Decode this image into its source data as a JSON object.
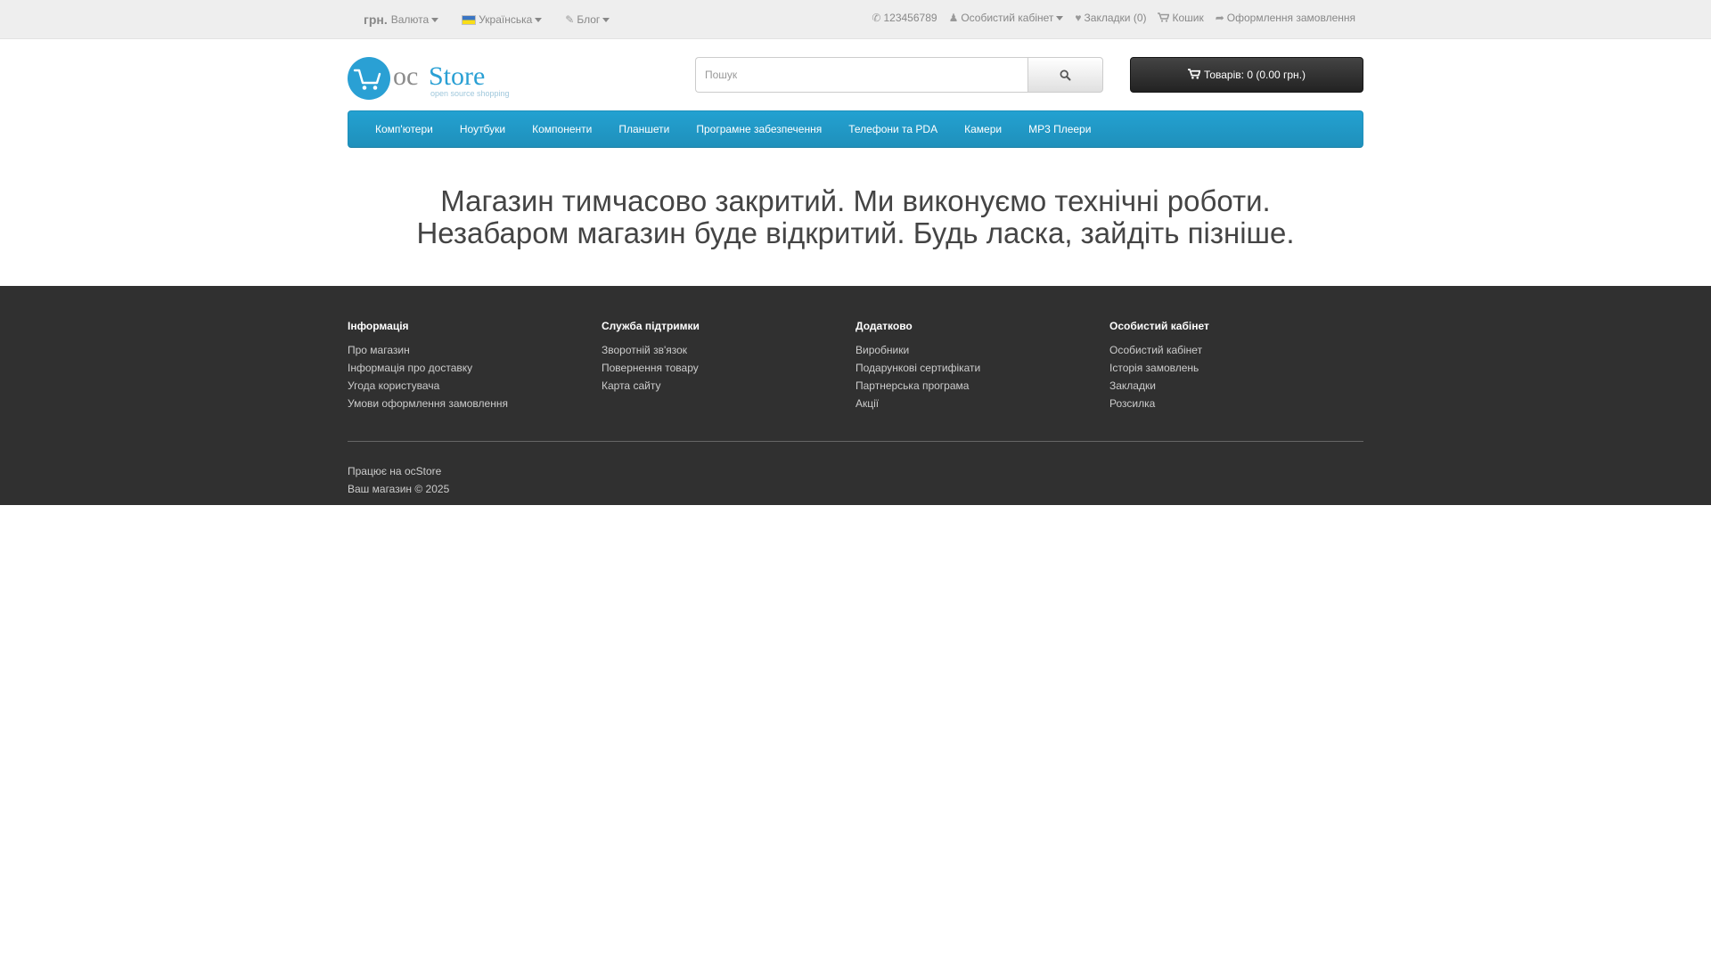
{
  "top": {
    "currency_symbol": "грн.",
    "currency_label": "Валюта",
    "language_label": "Українська",
    "blog_label": "Блог",
    "phone": "123456789",
    "account_label": "Особистий кабінет",
    "wishlist_label": "Закладки (0)",
    "cart_label": "Кошик",
    "checkout_label": "Оформлення замовлення"
  },
  "header": {
    "logo_text_oc": "oc",
    "logo_text_store": "Store",
    "logo_tagline": "open source shopping",
    "search_placeholder": "Пошук",
    "cart_button": "Товарів: 0 (0.00 грн.)"
  },
  "menu": {
    "items": [
      {
        "label": "Комп'ютери"
      },
      {
        "label": "Ноутбуки"
      },
      {
        "label": "Компоненти"
      },
      {
        "label": "Планшети"
      },
      {
        "label": "Програмне забезпечення"
      },
      {
        "label": "Телефони та PDA"
      },
      {
        "label": "Камери"
      },
      {
        "label": "MP3 Плеери"
      }
    ]
  },
  "content": {
    "line1": "Магазин тимчасово закритий. Ми виконуємо технічні роботи.",
    "line2": "Незабаром магазин буде відкритий. Будь ласка, зайдіть пізніше."
  },
  "footer": {
    "columns": [
      {
        "title": "Інформація",
        "links": [
          "Про магазин",
          "Інформація про доставку",
          "Угода користувача",
          "Умови оформлення замовлення"
        ]
      },
      {
        "title": "Служба підтримки",
        "links": [
          "Зворотній зв'язок",
          "Повернення товару",
          "Карта сайту"
        ]
      },
      {
        "title": "Додатково",
        "links": [
          "Виробники",
          "Подарункові сертифікати",
          "Партнерська програма",
          "Акції"
        ]
      },
      {
        "title": "Особистий кабінет",
        "links": [
          "Особистий кабінет",
          "Історія замовлень",
          "Закладки",
          "Розсилка"
        ]
      }
    ],
    "powered_prefix": "Працює на",
    "powered_brand": "ocStore",
    "copyright": "Ваш магазин © 2025"
  },
  "colors": {
    "menu_bg": "#229ac8",
    "footer_bg": "#303030",
    "top_bg": "#eeeeee",
    "logo_blue": "#2aa0d4"
  },
  "icons": [
    "phone-icon",
    "user-icon",
    "heart-icon",
    "shopping-cart-icon",
    "share-icon",
    "search-icon",
    "pencil-icon"
  ]
}
